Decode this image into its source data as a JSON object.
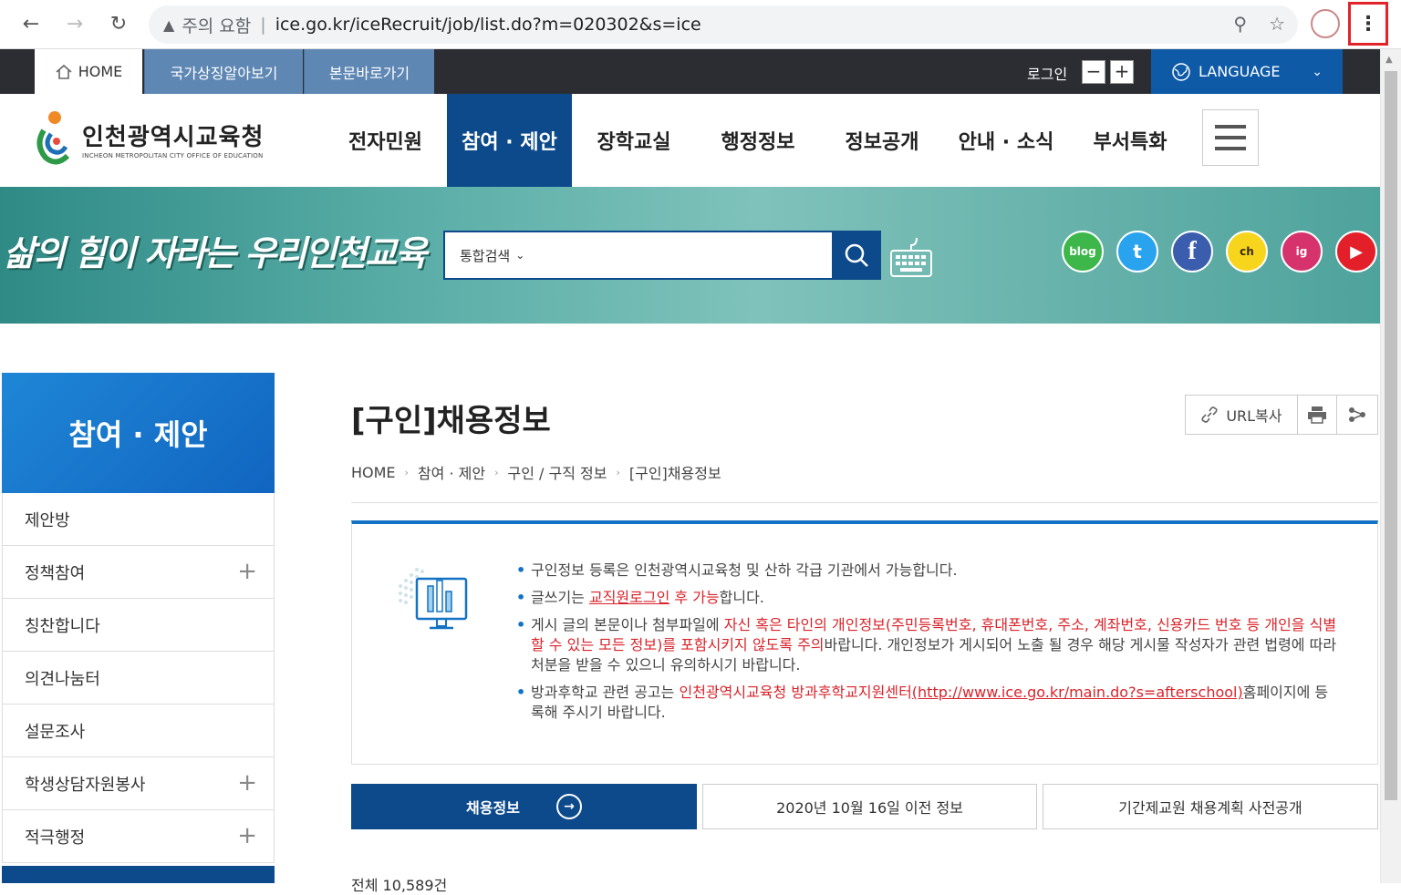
{
  "browser": {
    "security_label": "주의 요함",
    "url": "ice.go.kr/iceRecruit/job/list.do?m=020302&s=ice"
  },
  "utilbar": {
    "home": "HOME",
    "symbols": "국가상징알아보기",
    "skip": "본문바로가기",
    "login": "로그인",
    "zoom_out": "−",
    "zoom_in": "+",
    "language": "LANGUAGE"
  },
  "header": {
    "logo_title": "인천광역시교육청",
    "logo_sub": "INCHEON METROPOLITAN CITY OFFICE OF EDUCATION",
    "menu": [
      "전자민원",
      "참여 · 제안",
      "장학교실",
      "행정정보",
      "정보공개",
      "안내 · 소식",
      "부서특화"
    ]
  },
  "banner": {
    "slogan": "삶의 힘이 자라는 우리인천교육",
    "search_category": "통합검색"
  },
  "sns": [
    {
      "name": "blog",
      "label": "blog",
      "color": "#3db74a"
    },
    {
      "name": "twitter",
      "label": "t",
      "color": "#2aa3ef"
    },
    {
      "name": "facebook",
      "label": "f",
      "color": "#3b5dad"
    },
    {
      "name": "kakao",
      "label": "ch",
      "color": "#f7d51d"
    },
    {
      "name": "instagram",
      "label": "ig",
      "color": "#d6336c"
    },
    {
      "name": "youtube",
      "label": "▶",
      "color": "#e3202a"
    }
  ],
  "lnb": {
    "title": "참여 · 제안",
    "items": [
      {
        "label": "제안방",
        "plus": false
      },
      {
        "label": "정책참여",
        "plus": true
      },
      {
        "label": "칭찬합니다",
        "plus": false
      },
      {
        "label": "의견나눔터",
        "plus": false
      },
      {
        "label": "설문조사",
        "plus": false
      },
      {
        "label": "학생상담자원봉사",
        "plus": true
      },
      {
        "label": "적극행정",
        "plus": true
      }
    ]
  },
  "content": {
    "title": "[구인]채용정보",
    "url_copy": "URL복사",
    "breadcrumb": [
      "HOME",
      "참여 · 제안",
      "구인 / 구직 정보",
      "[구인]채용정보"
    ],
    "notice": {
      "item1": "구인정보 등록은 인천광역시교육청 및 산하 각급 기관에서 가능합니다.",
      "item2_pre": "글쓰기는 ",
      "item2_link": "교직원로그인",
      "item2_red": " 후 가능",
      "item2_post": "합니다.",
      "item3_pre": "게시 글의 본문이나 첨부파일에 ",
      "item3_red": "자신 혹은 타인의 개인정보(주민등록번호, 휴대폰번호, 주소, 계좌번호, 신용카드 번호 등 개인을 식별할 수 있는 모든 정보)를 포함시키지 않도록 주의",
      "item3_post": "바랍니다. 개인정보가 게시되어 노출 될 경우 해당 게시물 작성자가 관련 법령에 따라 처분을 받을 수 있으니 유의하시기 바랍니다.",
      "item4_pre": "방과후학교 관련 공고는 ",
      "item4_red": "인천광역시교육청 방과후학교지원센터",
      "item4_link": "(http://www.ice.go.kr/main.do?s=afterschool)",
      "item4_post": "홈페이지에 등록해 주시기 바랍니다."
    },
    "tabs": [
      "채용정보",
      "2020년 10월 16일 이전 정보",
      "기간제교원 채용계획 사전공개"
    ],
    "total": "전체 10,589건"
  }
}
